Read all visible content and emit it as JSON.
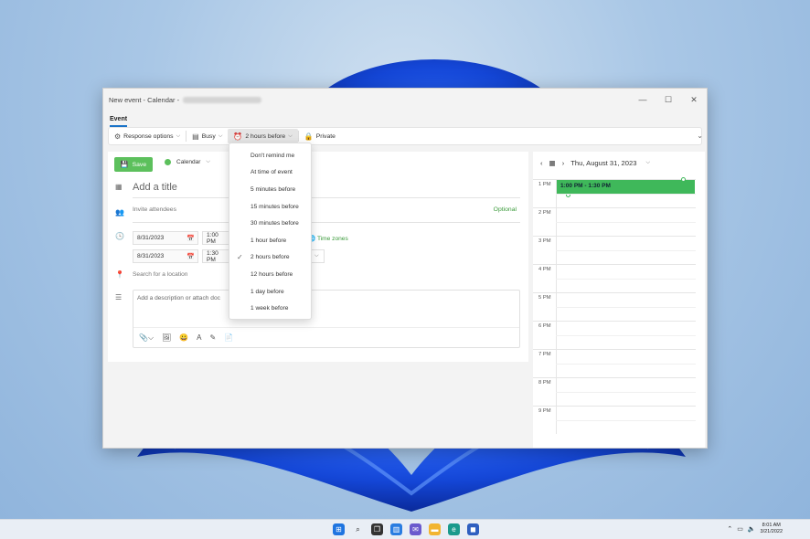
{
  "window": {
    "title": "New event - Calendar -",
    "controls": {
      "minimize": "—",
      "maximize": "☐",
      "close": "✕"
    }
  },
  "tabs": [
    {
      "label": "Event"
    }
  ],
  "toolbar": {
    "response_options": "Response options",
    "busy": "Busy",
    "reminder": "2 hours before",
    "private": "Private"
  },
  "form": {
    "save_label": "Save",
    "calendar_label": "Calendar",
    "calendar_color": "#5cc05c",
    "title_placeholder": "Add a title",
    "invite_placeholder": "Invite attendees",
    "optional_label": "Optional",
    "start_date": "8/31/2023",
    "start_time": "1:00 PM",
    "end_date": "8/31/2023",
    "end_time": "1:30 PM",
    "time_zones": "Time zones",
    "location_placeholder": "Search for a location",
    "description_placeholder": "Add a description or attach doc"
  },
  "reminder_menu": {
    "selected": "2 hours before",
    "items": [
      "Don't remind me",
      "At time of event",
      "5 minutes before",
      "15 minutes before",
      "30 minutes before",
      "1 hour before",
      "2 hours before",
      "12 hours before",
      "1 day before",
      "1 week before"
    ]
  },
  "calendar": {
    "date_heading": "Thu, August 31, 2023",
    "hours": [
      "1 PM",
      "2 PM",
      "3 PM",
      "4 PM",
      "5 PM",
      "6 PM",
      "7 PM",
      "8 PM",
      "9 PM"
    ],
    "event_label": "1:00 PM - 1:30 PM",
    "event_color": "#3fb85a"
  },
  "taskbar": {
    "time": "8:01 AM",
    "date": "3/21/2022"
  }
}
